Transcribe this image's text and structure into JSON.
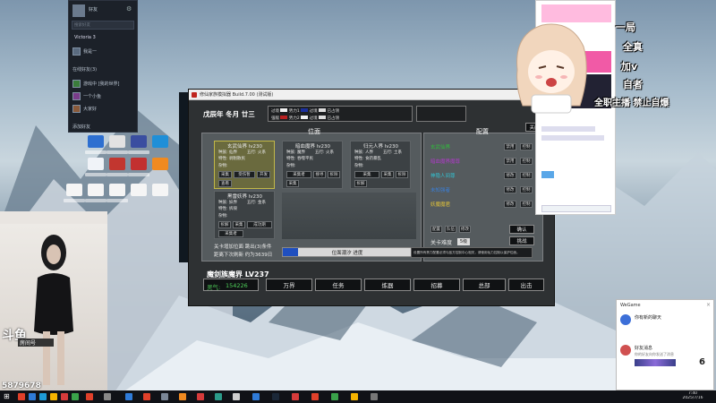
{
  "steam": {
    "title": "好友",
    "search_placeholder": "搜索好友",
    "friends_header": "Victoria 3",
    "items": [
      "我是一",
      "在线好友(3)",
      "游戏中 [我的世界]",
      "一个小鱼",
      "大家好"
    ],
    "add_friend": "添加好友"
  },
  "webcam": {
    "logo": "斗鱼",
    "room_label": "房间号",
    "room_id": "5879678"
  },
  "game": {
    "window_title": "修仙家族模拟器 Build.7.00 (测试版)",
    "date": {
      "era": "戊辰年",
      "month": "冬月",
      "day": "廿三"
    },
    "legend": [
      [
        "过境",
        "势力1",
        "过境",
        "已占领"
      ],
      [
        "强敌",
        "势力2",
        "过境",
        "已占领"
      ]
    ],
    "resource_hint": "超出安全量后不能建造...",
    "close_label": "关闭",
    "tab_left": "位面",
    "tab_right": "配置",
    "realms": [
      {
        "name": "玄武仙界 lv230",
        "rows": [
          [
            "种族: 仙界",
            "五行: 火系"
          ],
          [
            "特性: 剥削散民",
            ""
          ]
        ],
        "note": "杂物:",
        "buttons": [
          "采集",
          "受伤暂",
          "开发",
          "查看"
        ]
      },
      {
        "name": "暗血魔界 lv230",
        "rows": [
          [
            "种族: 魔界",
            "五行: 火系"
          ],
          [
            "特性: 吞噬平民",
            ""
          ]
        ],
        "note": "杂物:",
        "buttons": [
          "采集",
          "采集者",
          "搜寻",
          "拆除"
        ]
      },
      {
        "name": "归元人界 lv230",
        "rows": [
          [
            "种族: 人界",
            "五行: 土系"
          ],
          [
            "特性: 食药暴乱",
            ""
          ]
        ],
        "note": "杂物:",
        "buttons": [
          "采集",
          "采集",
          "拆除",
          "拆解"
        ]
      },
      {
        "name": "黑雷妖界 lv230",
        "rows": [
          [
            "种族: 妖界",
            "五行: 金系"
          ],
          [
            "特性: 拆毁",
            ""
          ]
        ],
        "note": "杂物:",
        "buttons": [
          "拆解",
          "采集",
          "成功期",
          "采集者"
        ]
      }
    ],
    "notice": "关卡增加位面 跳出(3)条件",
    "countdown": "距离下次刷新 约为3639日",
    "progress_label": "位面潮汐 进度",
    "progress_value": 0.12,
    "factions": [
      {
        "name": "玄武仙界",
        "color": "#2fbf3a",
        "btn1": "禁用",
        "btn2": "控制"
      },
      {
        "name": "暗血魔界魔尊",
        "color": "#b03ac9",
        "btn1": "禁用",
        "btn2": "控制"
      },
      {
        "name": "神隐人间尊",
        "color": "#33c0d0",
        "btn1": "修改",
        "btn2": "控制"
      },
      {
        "name": "未知强者",
        "color": "#3a7fd8",
        "btn1": "修改",
        "btn2": "控制"
      },
      {
        "name": "妖魔魔君",
        "color": "#e0c23a",
        "btn1": "修改",
        "btn2": "控制"
      }
    ],
    "small_buttons": [
      "配置",
      "队伍",
      "修改"
    ],
    "confirm": "确认",
    "difficulty_label": "关卡难度",
    "difficulty_value": "5级",
    "challenge": "挑战",
    "footer_hint": "设置所有势力配置必须与敌方控制中心相关，请使用仙力控制以保护位面。",
    "player": "魔剑族魔界 LV237",
    "qi_label": "灵气:",
    "qi_value": "154226",
    "nav": [
      "万界",
      "任务",
      "炼器",
      "招募",
      "总部",
      "出击"
    ]
  },
  "overlay": {
    "lines": [
      "一局",
      "全真",
      "加v",
      "自者",
      "全职主播 禁止自爆"
    ]
  },
  "chat_popup": {
    "app": "WeGame",
    "title": "你有新的聊天",
    "name": "好友消息",
    "preview": "你的好友向你发送了消息",
    "count": "6"
  },
  "clock": {
    "time": "7:40",
    "date": "2025/7/16"
  },
  "colors": {
    "game_bg": "#2e3133",
    "panel": "#555b5e",
    "accent_bar": "#1f4fbf"
  }
}
